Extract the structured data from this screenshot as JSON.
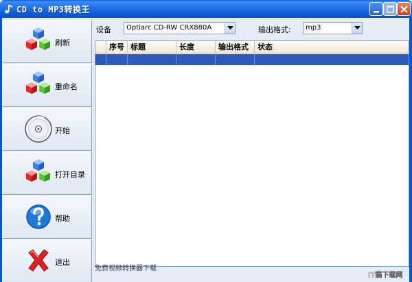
{
  "window": {
    "title": "CD to MP3转换王",
    "app_icon": "music-note-icon",
    "controls": [
      "minimize-icon",
      "maximize-icon",
      "close-icon"
    ]
  },
  "sidebar": {
    "items": [
      {
        "label": "刷新",
        "icon": "colored-cubes-icon"
      },
      {
        "label": "重命名",
        "icon": "colored-cubes-icon"
      },
      {
        "label": "开始",
        "icon": "cd-disc-icon"
      },
      {
        "label": "打开目录",
        "icon": "colored-cubes-icon"
      },
      {
        "label": "帮助",
        "icon": "help-question-icon"
      },
      {
        "label": "退出",
        "icon": "red-x-icon"
      }
    ]
  },
  "device": {
    "label": "设备",
    "selected": "Optiarc CD-RW CRX880A"
  },
  "output_format": {
    "label": "输出格式:",
    "selected": "mp3"
  },
  "track_list": {
    "columns": [
      "",
      "序号",
      "标题",
      "长度",
      "输出格式",
      "状态"
    ],
    "selected_row_index": 0
  },
  "status_text": "免费视频转换器下载",
  "watermark": "IT猫下载网",
  "colors": {
    "titlebar": "#1f6fe6",
    "selection": "#2f59bc",
    "client_bg": "#e6ecf5"
  }
}
